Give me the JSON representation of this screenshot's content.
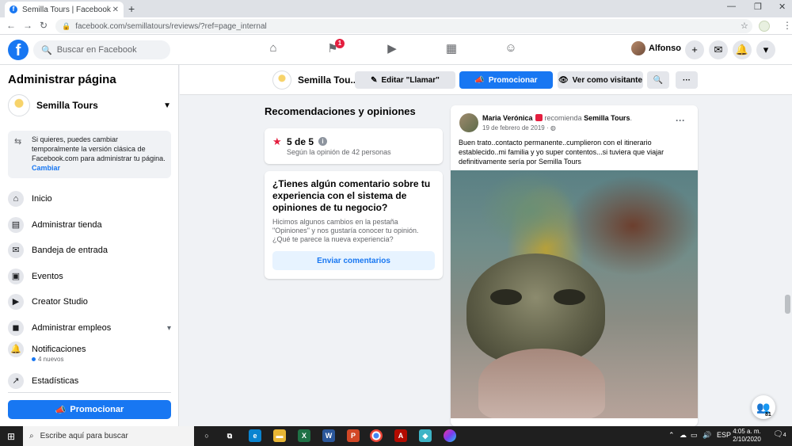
{
  "browser": {
    "tab_title": "Semilla Tours | Facebook",
    "url": "facebook.com/semillatours/reviews/?ref=page_internal"
  },
  "fb": {
    "search_placeholder": "Buscar en Facebook",
    "pages_badge": "1",
    "user_name": "Alfonso"
  },
  "sidebar": {
    "title": "Administrar página",
    "page_name": "Semilla Tours",
    "notice_text": "Si quieres, puedes cambiar temporalmente la versión clásica de Facebook.com para administrar tu página.",
    "notice_link": "Cambiar",
    "items": [
      {
        "label": "Inicio",
        "icon": "home-icon"
      },
      {
        "label": "Administrar tienda",
        "icon": "shop-icon"
      },
      {
        "label": "Bandeja de entrada",
        "icon": "inbox-icon"
      },
      {
        "label": "Eventos",
        "icon": "calendar-icon"
      },
      {
        "label": "Creator Studio",
        "icon": "video-icon"
      },
      {
        "label": "Administrar empleos",
        "icon": "briefcase-icon"
      },
      {
        "label": "Notificaciones",
        "icon": "bell-icon"
      },
      {
        "label": "Estadísticas",
        "icon": "chart-icon"
      }
    ],
    "notifications_sub": "4 nuevos",
    "promote_label": "Promocionar"
  },
  "pagebar": {
    "page_name": "Semilla Tou...",
    "edit_call": "Editar \"Llamar\"",
    "promote": "Promocionar",
    "view_as": "Ver como visitante"
  },
  "reviews": {
    "section_title": "Recomendaciones y opiniones",
    "score": "5 de 5",
    "score_sub": "Según la opinión de 42 personas",
    "feedback_title": "¿Tienes algún comentario sobre tu experiencia con el sistema de opiniones de tu negocio?",
    "feedback_text": "Hicimos algunos cambios en la pestaña \"Opiniones\" y nos gustaría conocer tu opinión. ¿Qué te parece la nueva experiencia?",
    "feedback_button": "Enviar comentarios"
  },
  "post": {
    "author": "Maria Verónica",
    "verb": "recomienda",
    "page": "Semilla Tours",
    "date": "19 de febrero de 2019 ·",
    "text": "Buen trato..contacto permanente..cumplieron con el itinerario establecido..mi familia y yo super contentos...si tuviera que viajar definitivamente sería por Semilla Tours"
  },
  "chat": {
    "count": "81"
  },
  "taskbar": {
    "search_placeholder": "Escribe aquí para buscar",
    "language": "ESP",
    "time": "4:05 a. m.",
    "date": "2/10/2020",
    "notifications": "4"
  },
  "colors": {
    "fb_blue": "#1877f2",
    "badge_red": "#e41e3f",
    "background": "#f0f2f5"
  }
}
